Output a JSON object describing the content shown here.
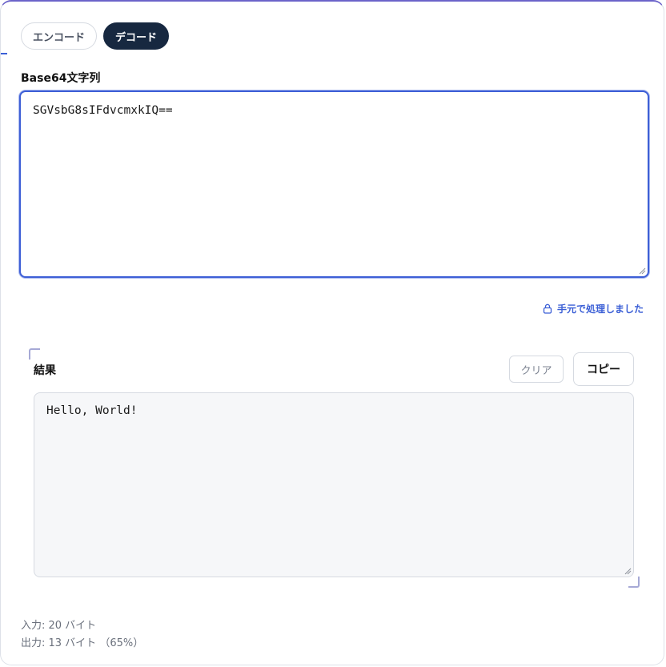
{
  "modes": {
    "encode_label": "エンコード",
    "decode_label": "デコード",
    "selected": "decode"
  },
  "input": {
    "label": "Base64文字列",
    "value": "SGVsbG8sIFdvcmxkIQ=="
  },
  "privacy_note": "手元で処理しました",
  "result": {
    "label": "結果",
    "clear_label": "クリア",
    "copy_label": "コピー",
    "value": "Hello, World!"
  },
  "stats": {
    "input_text": "入力: 20 バイト",
    "output_text": "出力: 13 バイト （65%）"
  },
  "colors": {
    "accent": "#3d5fd6",
    "dark_button": "#172840",
    "border_top": "#6b63c9"
  }
}
